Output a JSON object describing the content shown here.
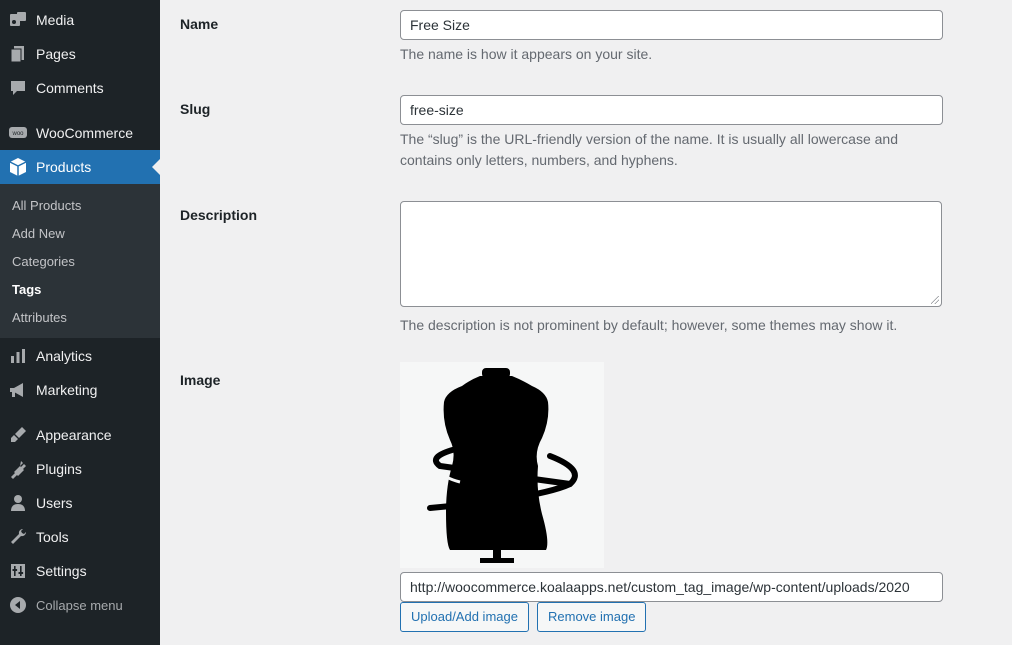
{
  "sidebar": {
    "items": [
      {
        "label": "Media",
        "icon": "media-icon"
      },
      {
        "label": "Pages",
        "icon": "pages-icon"
      },
      {
        "label": "Comments",
        "icon": "comments-icon"
      },
      {
        "label": "WooCommerce",
        "icon": "woocommerce-icon"
      },
      {
        "label": "Products",
        "icon": "products-icon",
        "active": true
      },
      {
        "label": "Analytics",
        "icon": "analytics-icon"
      },
      {
        "label": "Marketing",
        "icon": "marketing-icon"
      },
      {
        "label": "Appearance",
        "icon": "appearance-icon"
      },
      {
        "label": "Plugins",
        "icon": "plugins-icon"
      },
      {
        "label": "Users",
        "icon": "users-icon"
      },
      {
        "label": "Tools",
        "icon": "tools-icon"
      },
      {
        "label": "Settings",
        "icon": "settings-icon"
      }
    ],
    "submenu": [
      "All Products",
      "Add New",
      "Categories",
      "Tags",
      "Attributes"
    ],
    "submenu_current": "Tags",
    "collapse_label": "Collapse menu",
    "colors": {
      "bg": "#1d2327",
      "active": "#2271b1",
      "submenu_bg": "#2c3338"
    }
  },
  "form": {
    "name": {
      "label": "Name",
      "value": "Free Size",
      "help": "The name is how it appears on your site."
    },
    "slug": {
      "label": "Slug",
      "value": "free-size",
      "help": "The “slug” is the URL-friendly version of the name. It is usually all lowercase and contains only letters, numbers, and hyphens."
    },
    "description": {
      "label": "Description",
      "value": "",
      "help": "The description is not prominent by default; however, some themes may show it."
    },
    "image": {
      "label": "Image",
      "preview_icon": "dress-form-measuring-tape-icon",
      "url": "http://woocommerce.koalaapps.net/custom_tag_image/wp-content/uploads/2020",
      "upload_label": "Upload/Add image",
      "remove_label": "Remove image"
    }
  }
}
